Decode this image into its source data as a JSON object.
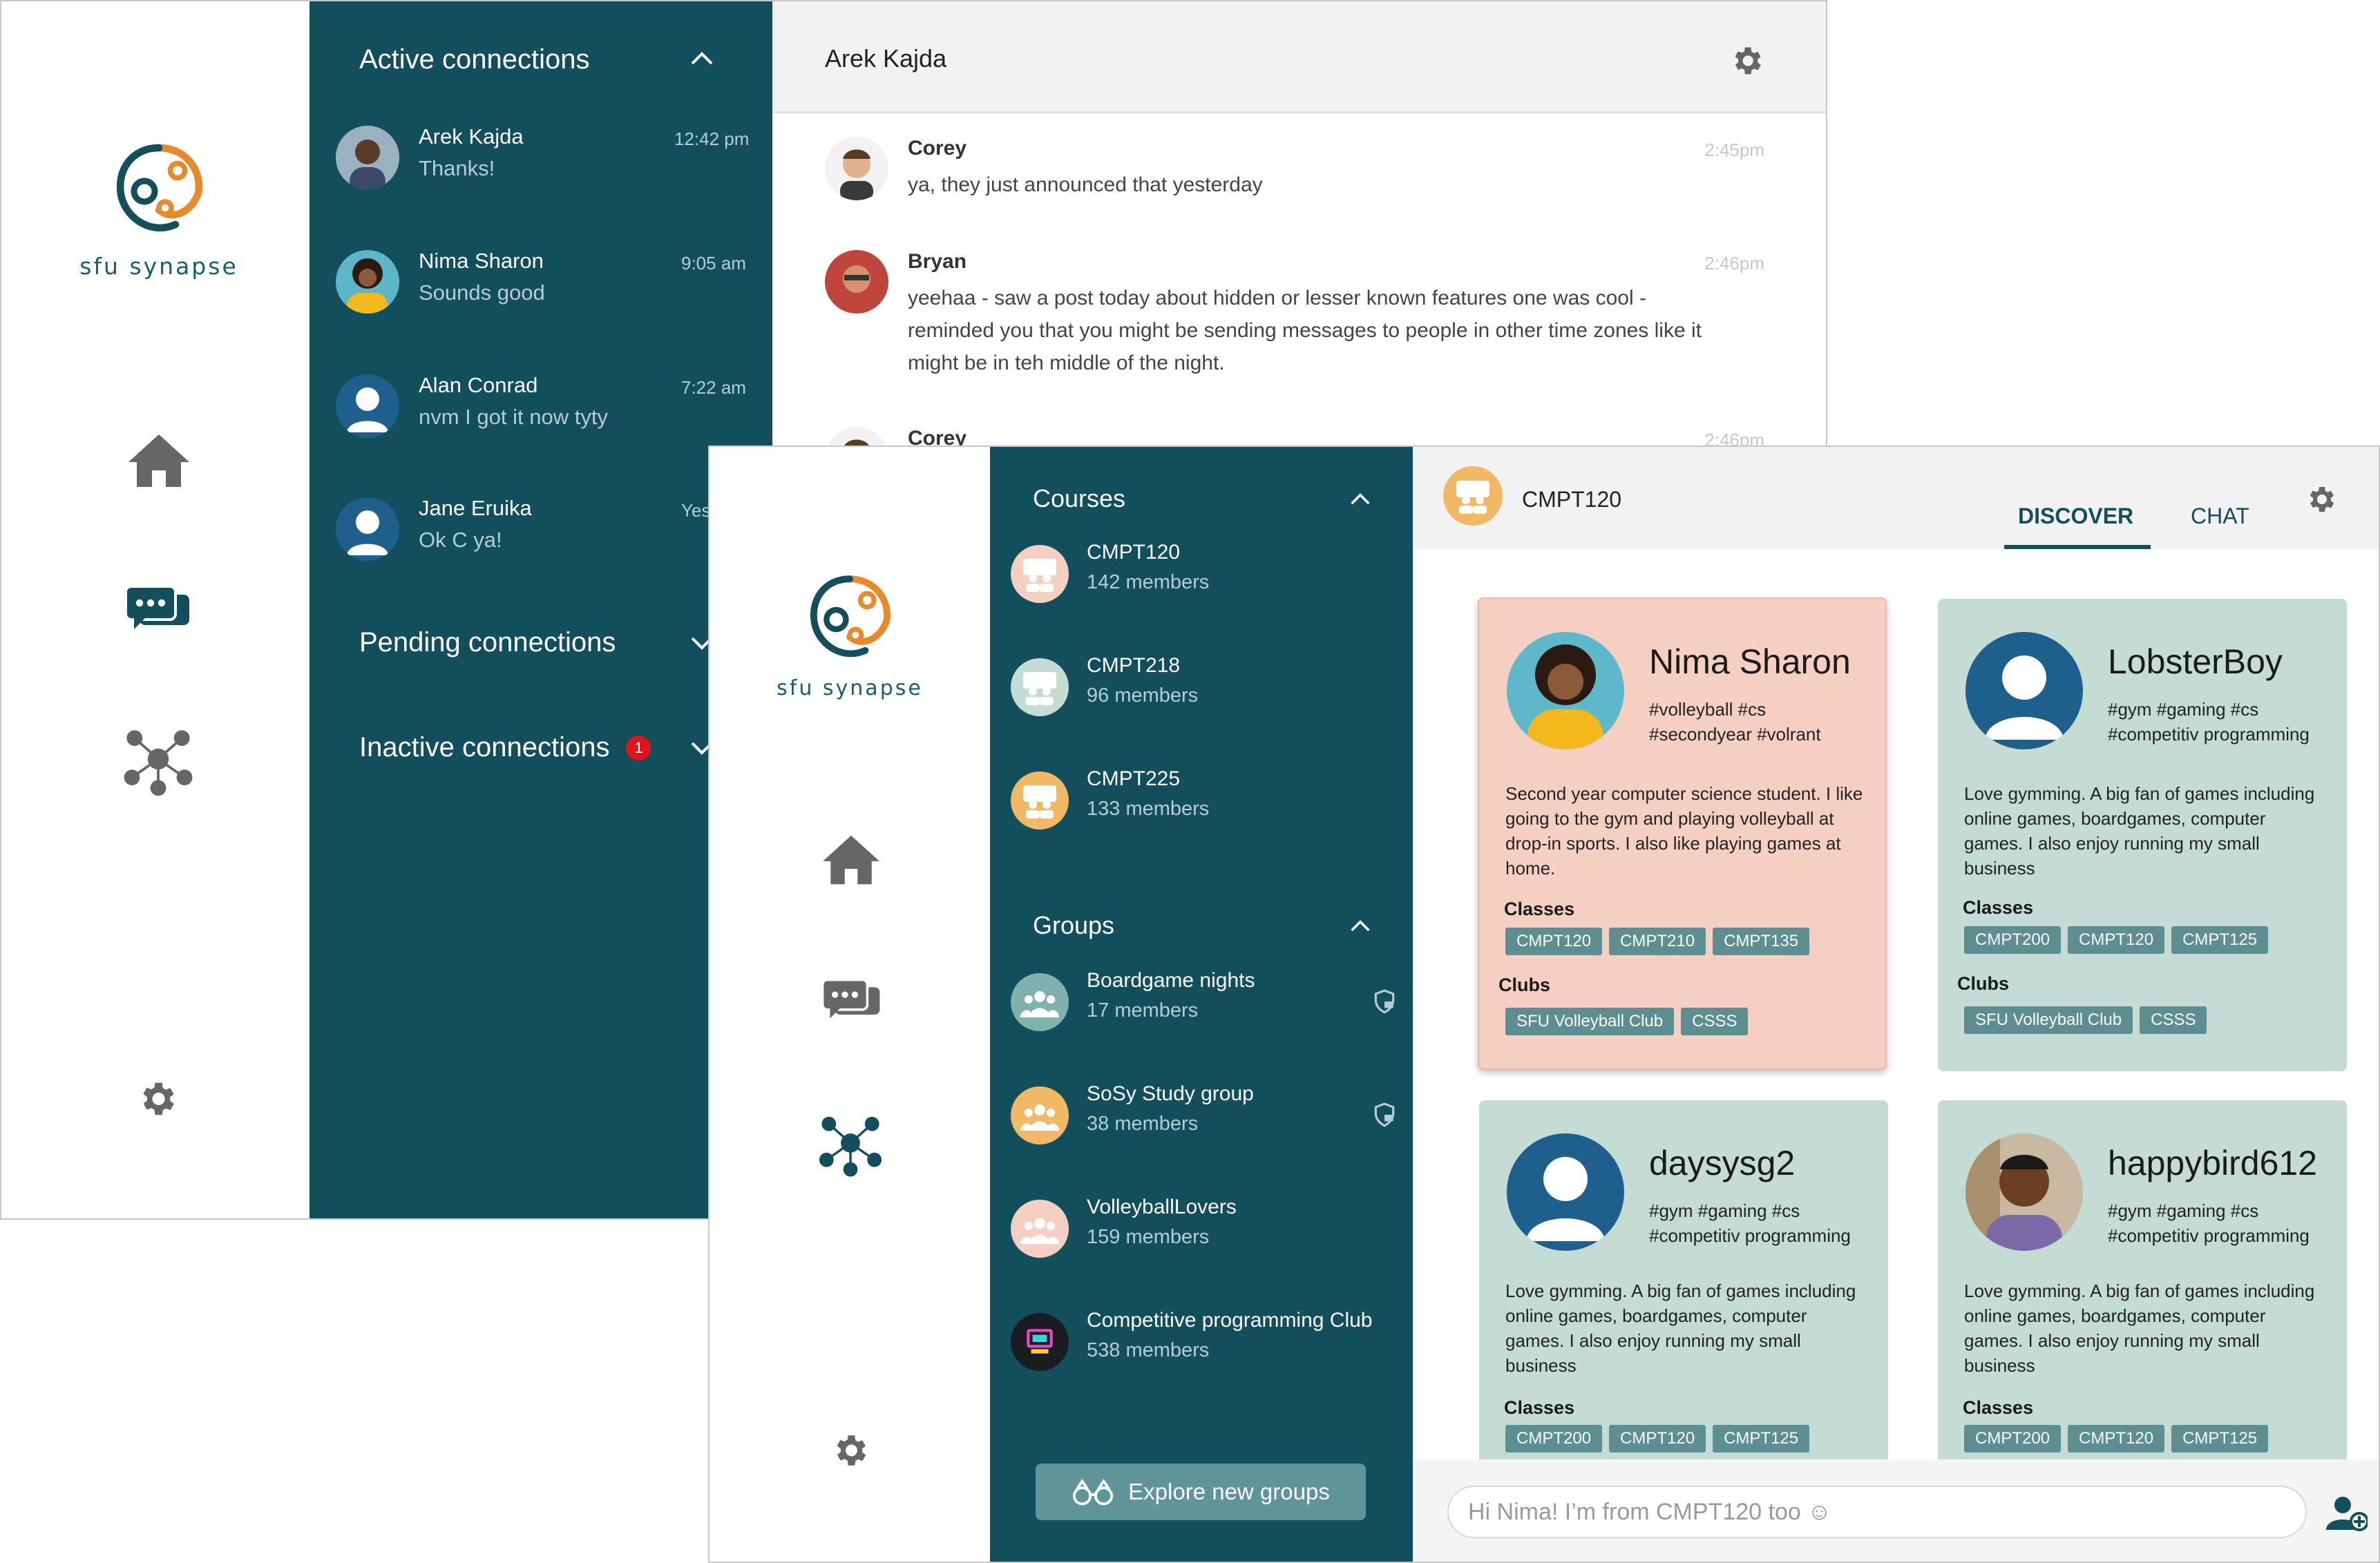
{
  "brand": {
    "logo_text": "sfu synapse"
  },
  "connections_window": {
    "sections": {
      "active": "Active connections",
      "pending": "Pending connections",
      "inactive": "Inactive connections",
      "inactive_badge": "1"
    },
    "conversations": [
      {
        "name": "Arek Kajda",
        "message": "Thanks!",
        "time": "12:42 pm"
      },
      {
        "name": "Nima Sharon",
        "message": "Sounds good",
        "time": "9:05 am"
      },
      {
        "name": "Alan Conrad",
        "message": "nvm I got it now tyty",
        "time": "7:22 am"
      },
      {
        "name": "Jane Eruika",
        "message": "Ok C ya!",
        "time": "Yesterday"
      }
    ],
    "chat": {
      "title": "Arek Kajda",
      "messages": [
        {
          "sender": "Corey",
          "text": "ya, they just announced that yesterday",
          "time": "2:45pm"
        },
        {
          "sender": "Bryan",
          "text": "yeehaa - saw a post today about hidden or lesser known features one was cool - reminded you that you might be sending messages to people in other time zones like it might be in teh middle of the night.",
          "time": "2:46pm"
        },
        {
          "sender": "Corey",
          "text": "",
          "time": "2:46pm"
        }
      ]
    }
  },
  "discover_window": {
    "courses_heading": "Courses",
    "courses": [
      {
        "name": "CMPT120",
        "members": "142 members"
      },
      {
        "name": "CMPT218",
        "members": "96 members"
      },
      {
        "name": "CMPT225",
        "members": "133 members"
      }
    ],
    "groups_heading": "Groups",
    "groups": [
      {
        "name": "Boardgame nights",
        "members": "17 members"
      },
      {
        "name": "SoSy Study group",
        "members": "38 members"
      },
      {
        "name": "VolleyballLovers",
        "members": "159 members"
      },
      {
        "name": "Competitive programming Club",
        "members": "538 members"
      }
    ],
    "explore_label": "Explore new groups",
    "header": {
      "title": "CMPT120",
      "tab_discover": "DISCOVER",
      "tab_chat": "CHAT"
    },
    "labels": {
      "classes": "Classes",
      "clubs": "Clubs"
    },
    "profiles": [
      {
        "name": "Nima Sharon",
        "tags": "#volleyball #cs #secondyear #volrant",
        "bio": "Second year computer science student. I like going to the gym and playing volleyball at drop-in sports. I also like playing games at home.",
        "classes": [
          "CMPT120",
          "CMPT210",
          "CMPT135"
        ],
        "clubs": [
          "SFU Volleyball Club",
          "CSSS"
        ]
      },
      {
        "name": "LobsterBoy",
        "tags": "#gym #gaming #cs #competitiv programming",
        "bio": "Love gymming. A big fan of games including online games, boardgames, computer games. I also enjoy running my small business",
        "classes": [
          "CMPT200",
          "CMPT120",
          "CMPT125"
        ],
        "clubs": [
          "SFU Volleyball Club",
          "CSSS"
        ]
      },
      {
        "name": "daysysg2",
        "tags": "#gym #gaming #cs #competitiv programming",
        "bio": "Love gymming. A big fan of games including online games, boardgames, computer games. I also enjoy running my small business",
        "classes": [
          "CMPT200",
          "CMPT120",
          "CMPT125"
        ]
      },
      {
        "name": "happybird612",
        "tags": "#gym #gaming #cs #competitiv programming",
        "bio": "Love gymming. A big fan of games including online games, boardgames, computer games. I also enjoy running my small business",
        "classes": [
          "CMPT200",
          "CMPT120",
          "CMPT125"
        ]
      }
    ],
    "compose_placeholder": "Hi Nima! I’m from CMPT120 too ☺"
  },
  "colors": {
    "panel": "#124e5c",
    "peach_card": "#f6cfc3",
    "teal_card": "#c5dcd4",
    "chip": "#5c8e92",
    "badge": "#e0141b"
  }
}
